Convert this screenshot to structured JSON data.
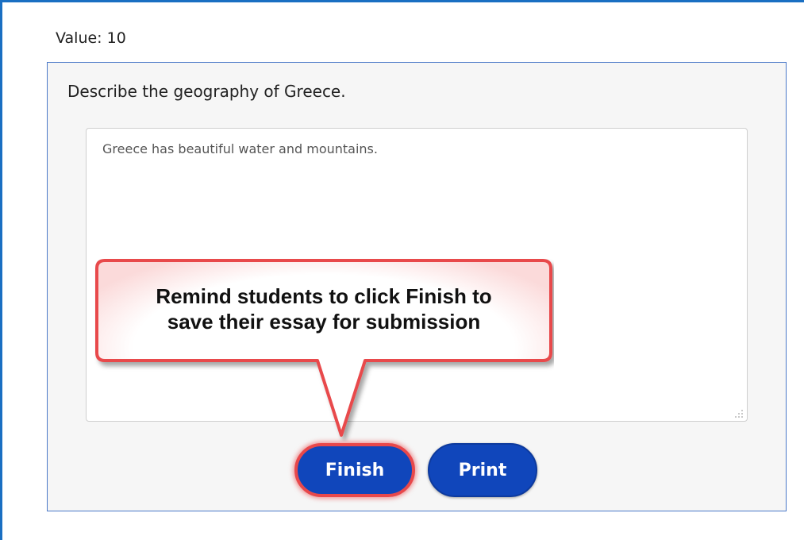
{
  "question": {
    "value_label": "Value: 10",
    "prompt": "Describe the geography of Greece.",
    "answer": "Greece has beautiful water and mountains."
  },
  "buttons": {
    "finish_label": "Finish",
    "print_label": "Print"
  },
  "callout": {
    "line1": "Remind students to click Finish to",
    "line2": "save their essay for submission"
  },
  "colors": {
    "button_blue": "#1046bb",
    "callout_border": "#e8484b",
    "panel_border": "#4a78c8"
  },
  "icons": {
    "resize_grip": "resize-grip-icon"
  }
}
